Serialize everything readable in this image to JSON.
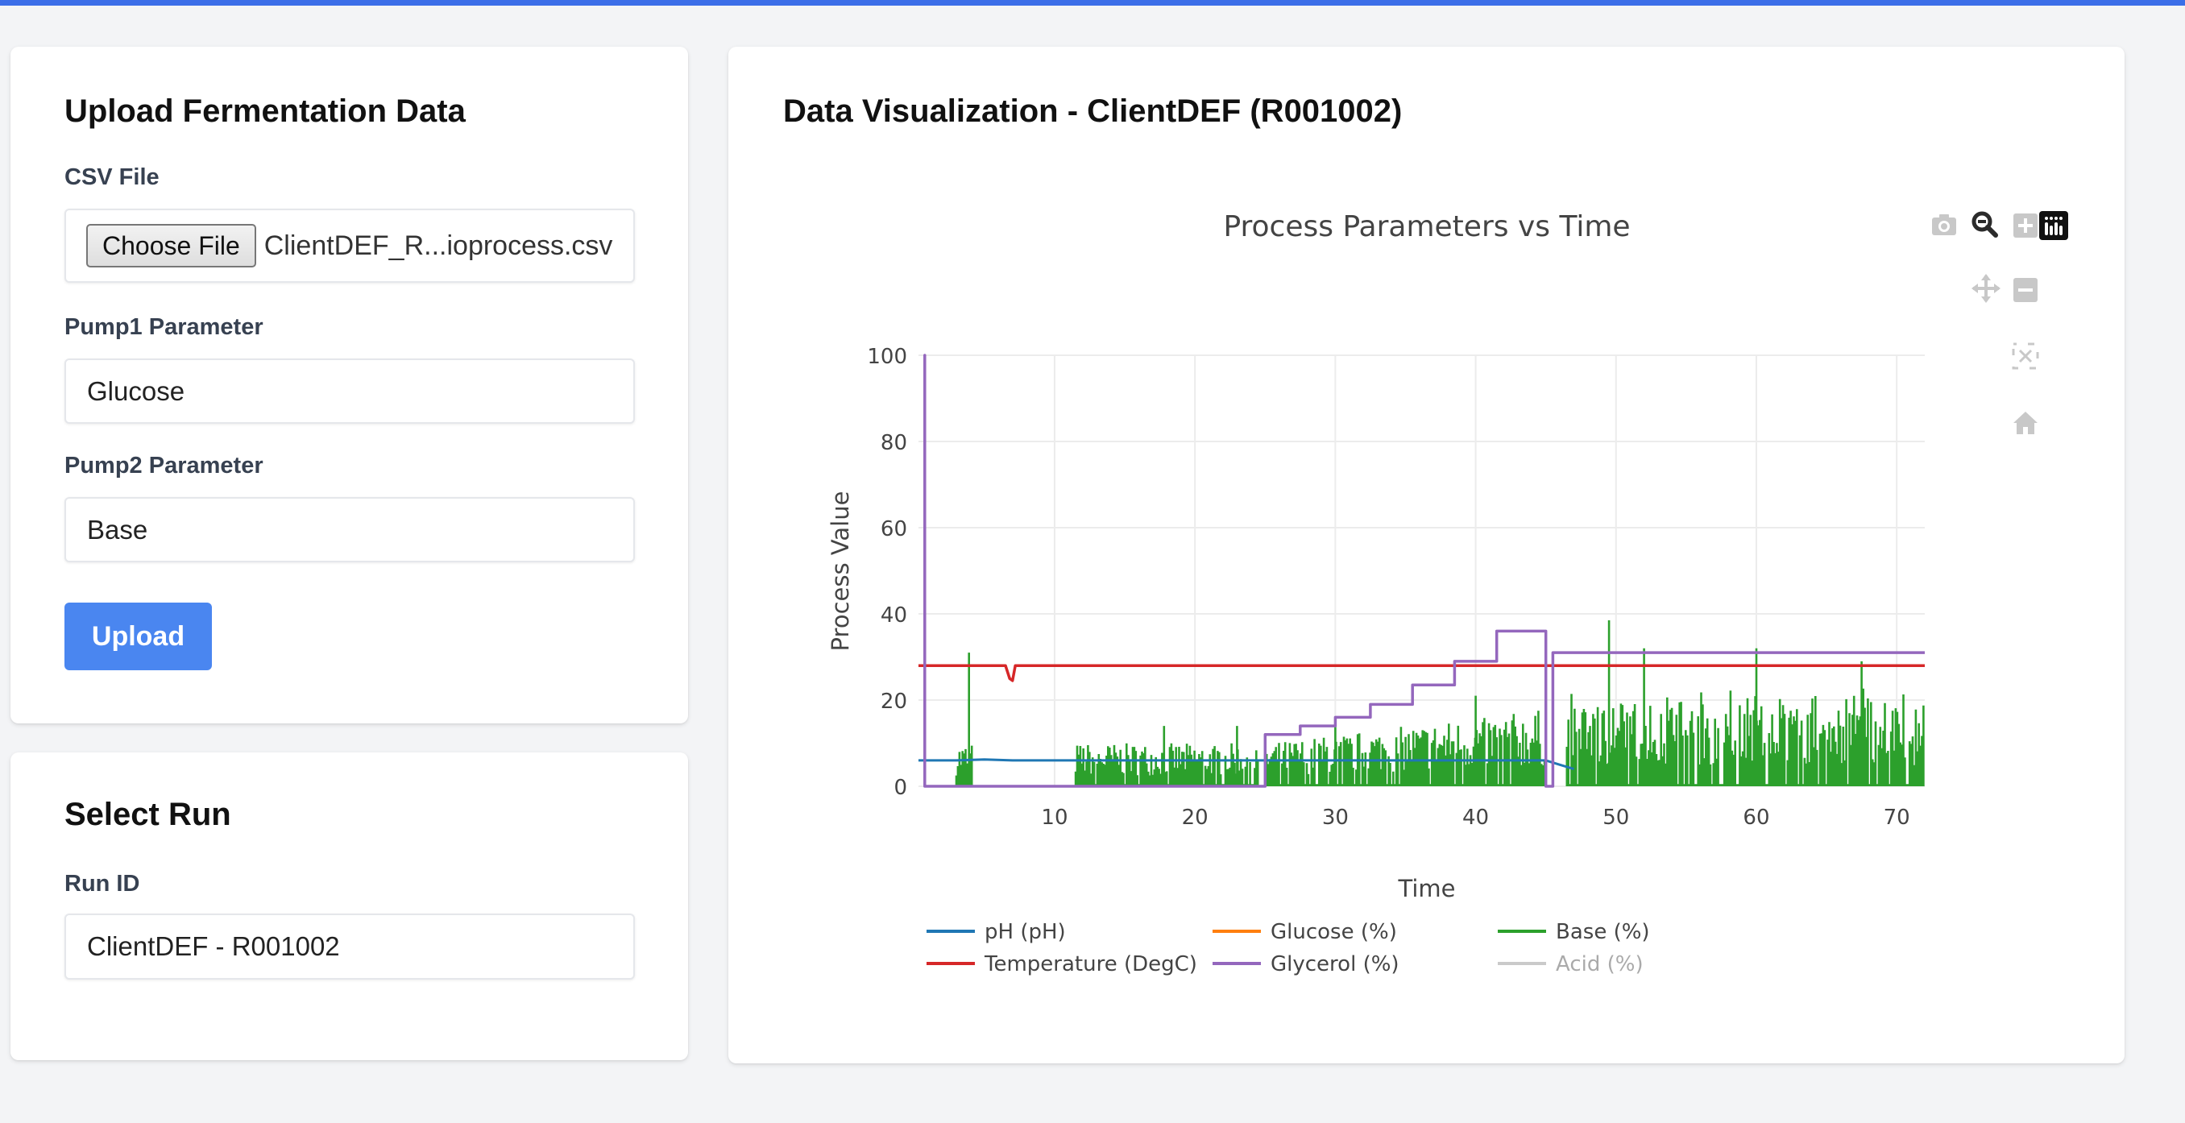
{
  "upload": {
    "title": "Upload Fermentation Data",
    "csv_label": "CSV File",
    "choose_file_label": "Choose File",
    "file_name": "ClientDEF_R...ioprocess.csv",
    "pump1_label": "Pump1 Parameter",
    "pump1_value": "Glucose",
    "pump2_label": "Pump2 Parameter",
    "pump2_value": "Base",
    "upload_label": "Upload"
  },
  "select_run": {
    "title": "Select Run",
    "run_id_label": "Run ID",
    "run_id_value": "ClientDEF - R001002"
  },
  "viz": {
    "title": "Data Visualization - ClientDEF (R001002)"
  },
  "modebar": [
    "camera-icon",
    "zoom-icon",
    "zoom-in-icon",
    "plotly-logo-icon",
    "pan-icon",
    "zoom-out-icon",
    "autoscale-icon",
    "reset-axes-icon"
  ],
  "chart_data": {
    "type": "line",
    "title": "Process Parameters vs Time",
    "xlabel": "Time",
    "ylabel": "Process Value",
    "xlim": [
      0.3,
      72
    ],
    "ylim": [
      0,
      100
    ],
    "x_ticks": [
      10,
      20,
      30,
      40,
      50,
      60,
      70
    ],
    "y_ticks": [
      0,
      20,
      40,
      60,
      80,
      100
    ],
    "grid": true,
    "legend_placement": "bottom",
    "series": [
      {
        "name": "pH (pH)",
        "color": "#1f77b4",
        "visible": true,
        "x": [
          0.3,
          3,
          5,
          7,
          9,
          12,
          20,
          30,
          40,
          45,
          46,
          47
        ],
        "y": [
          6,
          6,
          6.2,
          6,
          6,
          6,
          6,
          6,
          6,
          6,
          5,
          4
        ]
      },
      {
        "name": "Temperature (DegC)",
        "color": "#d62728",
        "visible": true,
        "x": [
          0.3,
          6.5,
          6.8,
          7.0,
          7.2,
          7.5,
          72
        ],
        "y": [
          28,
          28,
          25,
          24.5,
          28,
          28,
          28
        ]
      },
      {
        "name": "Glucose (%)",
        "color": "#ff7f0e",
        "visible": true,
        "x": [],
        "y": []
      },
      {
        "name": "Glycerol (%)",
        "color": "#9467bd",
        "visible": true,
        "x": [
          0.75,
          0.75,
          0.75,
          25,
          25,
          27.5,
          27.5,
          30,
          30,
          32.5,
          32.5,
          35.5,
          35.5,
          38.5,
          38.5,
          41.5,
          41.5,
          45,
          45,
          45.5,
          45.5,
          72
        ],
        "y": [
          0,
          100,
          0,
          0,
          12,
          12,
          14,
          14,
          16,
          16,
          19,
          19,
          23.5,
          23.5,
          29,
          29,
          36,
          36,
          0,
          0,
          31,
          31
        ]
      },
      {
        "name": "Base (%)",
        "color": "#2ca02c",
        "visible": true,
        "segments": [
          [
            3,
            4.2
          ],
          [
            11.5,
            24.5
          ],
          [
            25,
            45
          ],
          [
            46.5,
            72
          ]
        ],
        "peaks": [
          {
            "x": 3.9,
            "y": 31
          },
          {
            "x": 17.8,
            "y": 14
          },
          {
            "x": 23,
            "y": 14
          },
          {
            "x": 30,
            "y": 16
          },
          {
            "x": 40,
            "y": 21
          },
          {
            "x": 45,
            "y": 22
          },
          {
            "x": 49.5,
            "y": 38.5
          },
          {
            "x": 52,
            "y": 32
          },
          {
            "x": 60,
            "y": 32
          },
          {
            "x": 67.5,
            "y": 29
          }
        ]
      },
      {
        "name": "Acid (%)",
        "color": "#8c8c8c",
        "visible": "legendonly",
        "x": [],
        "y": []
      }
    ]
  }
}
